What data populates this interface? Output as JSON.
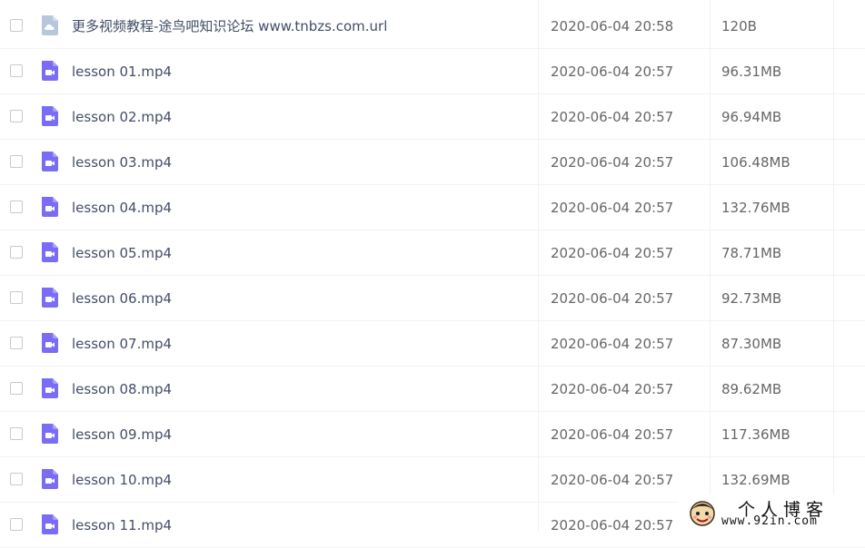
{
  "files": [
    {
      "name": "更多视频教程-途鸟吧知识论坛 www.tnbzs.com.url",
      "date": "2020-06-04 20:58",
      "size": "120B",
      "icon": "url-file-icon"
    },
    {
      "name": "lesson 01.mp4",
      "date": "2020-06-04 20:57",
      "size": "96.31MB",
      "icon": "video-file-icon"
    },
    {
      "name": "lesson 02.mp4",
      "date": "2020-06-04 20:57",
      "size": "96.94MB",
      "icon": "video-file-icon"
    },
    {
      "name": "lesson 03.mp4",
      "date": "2020-06-04 20:57",
      "size": "106.48MB",
      "icon": "video-file-icon"
    },
    {
      "name": "lesson 04.mp4",
      "date": "2020-06-04 20:57",
      "size": "132.76MB",
      "icon": "video-file-icon"
    },
    {
      "name": "lesson 05.mp4",
      "date": "2020-06-04 20:57",
      "size": "78.71MB",
      "icon": "video-file-icon"
    },
    {
      "name": "lesson 06.mp4",
      "date": "2020-06-04 20:57",
      "size": "92.73MB",
      "icon": "video-file-icon"
    },
    {
      "name": "lesson 07.mp4",
      "date": "2020-06-04 20:57",
      "size": "87.30MB",
      "icon": "video-file-icon"
    },
    {
      "name": "lesson 08.mp4",
      "date": "2020-06-04 20:57",
      "size": "89.62MB",
      "icon": "video-file-icon"
    },
    {
      "name": "lesson 09.mp4",
      "date": "2020-06-04 20:57",
      "size": "117.36MB",
      "icon": "video-file-icon"
    },
    {
      "name": "lesson 10.mp4",
      "date": "2020-06-04 20:57",
      "size": "132.69MB",
      "icon": "video-file-icon"
    },
    {
      "name": "lesson 11.mp4",
      "date": "2020-06-04 20:57",
      "size": "",
      "icon": "video-file-icon"
    }
  ],
  "watermark": {
    "title": "个人博客",
    "url": "www.92in.com"
  },
  "colors": {
    "video_icon": "#7b6cf6",
    "url_icon": "#b8c6dd",
    "text": "#424e67",
    "meta_text": "#666666"
  }
}
